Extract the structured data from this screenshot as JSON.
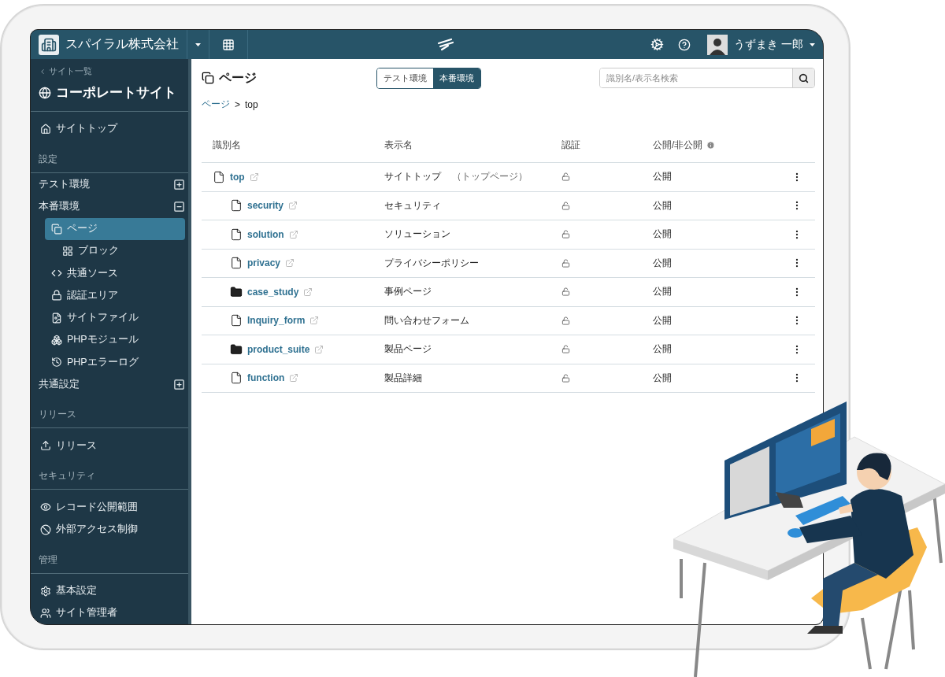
{
  "header": {
    "company": "スパイラル株式会社",
    "user": "うずまき 一郎"
  },
  "sidebar": {
    "back_link": "サイト一覧",
    "site_name": "コーポレートサイト",
    "items": [
      {
        "kind": "link",
        "label": "サイトトップ",
        "selected": false
      },
      {
        "kind": "heading",
        "label": "設定"
      },
      {
        "kind": "group",
        "label": "テスト環境",
        "expanded": false
      },
      {
        "kind": "group",
        "label": "本番環境",
        "expanded": true,
        "children": [
          {
            "kind": "link",
            "label": "ページ",
            "selected": true,
            "children": [
              {
                "kind": "link",
                "label": "ブロック",
                "selected": false
              }
            ]
          },
          {
            "kind": "link",
            "label": "共通ソース",
            "selected": false
          },
          {
            "kind": "link",
            "label": "認証エリア",
            "selected": false
          },
          {
            "kind": "link",
            "label": "サイトファイル",
            "selected": false
          },
          {
            "kind": "link",
            "label": "PHPモジュール",
            "selected": false
          },
          {
            "kind": "link",
            "label": "PHPエラーログ",
            "selected": false
          }
        ]
      },
      {
        "kind": "group",
        "label": "共通設定",
        "expanded": false
      },
      {
        "kind": "heading",
        "label": "リリース"
      },
      {
        "kind": "link",
        "label": "リリース",
        "selected": false
      },
      {
        "kind": "heading",
        "label": "セキュリティ"
      },
      {
        "kind": "link",
        "label": "レコード公開範囲",
        "selected": false
      },
      {
        "kind": "link",
        "label": "外部アクセス制御",
        "selected": false
      },
      {
        "kind": "heading",
        "label": "管理"
      },
      {
        "kind": "link",
        "label": "基本設定",
        "selected": false
      },
      {
        "kind": "link",
        "label": "サイト管理者",
        "selected": false
      }
    ]
  },
  "main": {
    "title": "ページ",
    "env_tabs": [
      {
        "label": "テスト環境",
        "selected": false
      },
      {
        "label": "本番環境",
        "selected": true
      }
    ],
    "search": {
      "placeholder": "識別名/表示名検索"
    },
    "breadcrumb": [
      "ページ",
      "top"
    ],
    "breadcrumb_separator": ">",
    "table": {
      "columns": [
        "識別名",
        "表示名",
        "認証",
        "公開/非公開"
      ],
      "rows": [
        {
          "kind": "page",
          "id": "top",
          "display": "サイトトップ",
          "display_note": "（トップページ）",
          "locked": false,
          "status": "公開",
          "children": [
            {
              "kind": "page",
              "id": "security",
              "display": "セキュリティ",
              "locked": false,
              "status": "公開"
            },
            {
              "kind": "page",
              "id": "solution",
              "display": "ソリューション",
              "locked": false,
              "status": "公開"
            },
            {
              "kind": "page",
              "id": "privacy",
              "display": "プライバシーポリシー",
              "locked": false,
              "status": "公開"
            },
            {
              "kind": "folder",
              "id": "case_study",
              "display": "事例ページ",
              "locked": false,
              "status": "公開"
            },
            {
              "kind": "page",
              "id": "Inquiry_form",
              "display": "問い合わせフォーム",
              "locked": false,
              "status": "公開"
            },
            {
              "kind": "folder",
              "id": "product_suite",
              "display": "製品ページ",
              "locked": false,
              "status": "公開"
            },
            {
              "kind": "page",
              "id": "function",
              "display": "製品詳細",
              "locked": false,
              "status": "公開"
            }
          ]
        }
      ]
    }
  }
}
